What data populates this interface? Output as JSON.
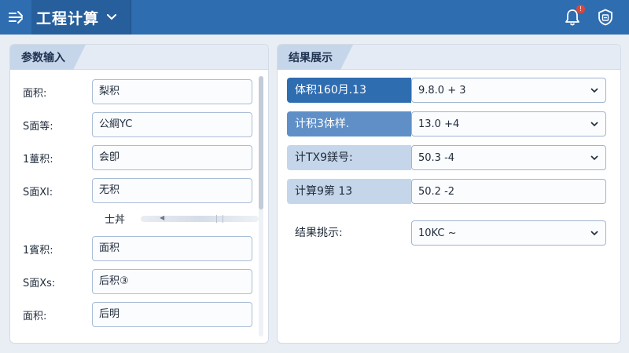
{
  "app": {
    "title": "工程计算",
    "notification_count": "!"
  },
  "icons": {
    "menu": "menu-icon",
    "title_dropdown": "chevron-down-icon",
    "notifications": "bell-icon",
    "settings": "shield-icon"
  },
  "colors": {
    "topbar": "#2f6db1",
    "accent": "#2f6db1",
    "badge": "#e0453a"
  },
  "left_panel": {
    "title": "参数输入",
    "fields": [
      {
        "label": "面积:",
        "value": "梨积"
      },
      {
        "label": "S面等:",
        "value": "公綱YC"
      },
      {
        "label": "1蕫积:",
        "value": "会卽"
      },
      {
        "label": "S面Xl:",
        "value": "无积"
      },
      {
        "label": "1賓积:",
        "value": "面积"
      },
      {
        "label": "S面Xs:",
        "value": "后积③"
      },
      {
        "label": "面积:",
        "value": "后明"
      }
    ],
    "middle_label": "士丼"
  },
  "right_panel": {
    "title": "结果展示",
    "rows": [
      {
        "label": "体积160月.13",
        "value": "9.8.0 + 3"
      },
      {
        "label": "计积3体样.",
        "value": "13.0 +4"
      },
      {
        "label": "计TX9鎂号:",
        "value": "50.3 -4"
      },
      {
        "label": "计算9第 13",
        "value": "50.2 -2"
      },
      {
        "label": "结果挑示:",
        "value": "10KC ~"
      }
    ]
  }
}
